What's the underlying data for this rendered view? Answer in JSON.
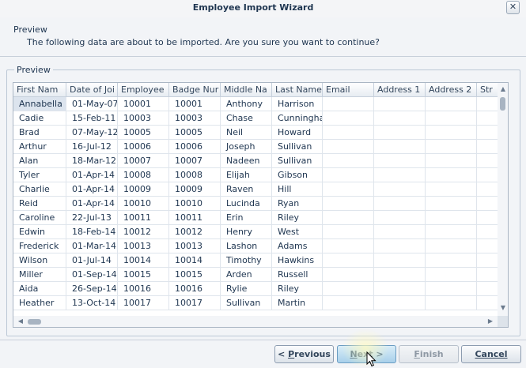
{
  "window": {
    "title": "Employee Import Wizard",
    "close_label": "✕"
  },
  "header": {
    "title": "Preview",
    "description": "The following data are about to be imported. Are you sure you want to continue?"
  },
  "group": {
    "legend": "Preview"
  },
  "grid": {
    "columns": [
      "First Nam",
      "Date of Joi",
      "Employee",
      "Badge Nur",
      "Middle Na",
      "Last Name",
      "Email",
      "Address 1",
      "Address 2",
      "Str"
    ],
    "rows": [
      [
        "Annabella",
        "01-May-07",
        "10001",
        "10001",
        "Anthony",
        "Harrison",
        "",
        "",
        "",
        ""
      ],
      [
        "Cadie",
        "15-Feb-11",
        "10003",
        "10003",
        "Chase",
        "Cunningha",
        "",
        "",
        "",
        ""
      ],
      [
        "Brad",
        "07-May-12",
        "10005",
        "10005",
        "Neil",
        "Howard",
        "",
        "",
        "",
        ""
      ],
      [
        "Arthur",
        "16-Jul-12",
        "10006",
        "10006",
        "Joseph",
        "Sullivan",
        "",
        "",
        "",
        ""
      ],
      [
        "Alan",
        "18-Mar-12",
        "10007",
        "10007",
        "Nadeen",
        "Sullivan",
        "",
        "",
        "",
        ""
      ],
      [
        "Tyler",
        "01-Apr-14",
        "10008",
        "10008",
        "Elijah",
        "Gibson",
        "",
        "",
        "",
        ""
      ],
      [
        "Charlie",
        "01-Apr-14",
        "10009",
        "10009",
        "Raven",
        "Hill",
        "",
        "",
        "",
        ""
      ],
      [
        "Reid",
        "01-Apr-14",
        "10010",
        "10010",
        "Lucinda",
        "Ryan",
        "",
        "",
        "",
        ""
      ],
      [
        "Caroline",
        "22-Jul-13",
        "10011",
        "10011",
        "Erin",
        "Riley",
        "",
        "",
        "",
        ""
      ],
      [
        "Edwin",
        "18-Feb-14",
        "10012",
        "10012",
        "Henry",
        "West",
        "",
        "",
        "",
        ""
      ],
      [
        "Frederick",
        "01-Mar-14",
        "10013",
        "10013",
        "Lashon",
        "Adams",
        "",
        "",
        "",
        ""
      ],
      [
        "Wilson",
        "01-Jul-14",
        "10014",
        "10014",
        "Timothy",
        "Hawkins",
        "",
        "",
        "",
        ""
      ],
      [
        "Miller",
        "01-Sep-14",
        "10015",
        "10015",
        "Arden",
        "Russell",
        "",
        "",
        "",
        ""
      ],
      [
        "Aida",
        "26-Sep-14",
        "10016",
        "10016",
        "Rylie",
        "Riley",
        "",
        "",
        "",
        ""
      ],
      [
        "Heather",
        "13-Oct-14",
        "10017",
        "10017",
        "Sullivan",
        "Martin",
        "",
        "",
        "",
        ""
      ]
    ],
    "selected_row": 0
  },
  "buttons": {
    "previous": {
      "mnemonic": "P",
      "rest": "revious"
    },
    "next": {
      "mnemonic": "N",
      "rest": "ext >"
    },
    "finish": {
      "mnemonic": "F",
      "rest": "inish"
    },
    "cancel": {
      "label": "Cancel"
    }
  },
  "icons": {
    "close": "close-icon",
    "scroll_up": "chevron-up-icon",
    "scroll_down": "chevron-down-icon",
    "scroll_left": "chevron-left-icon",
    "scroll_right": "chevron-right-icon",
    "cursor": "mouse-pointer-icon"
  }
}
